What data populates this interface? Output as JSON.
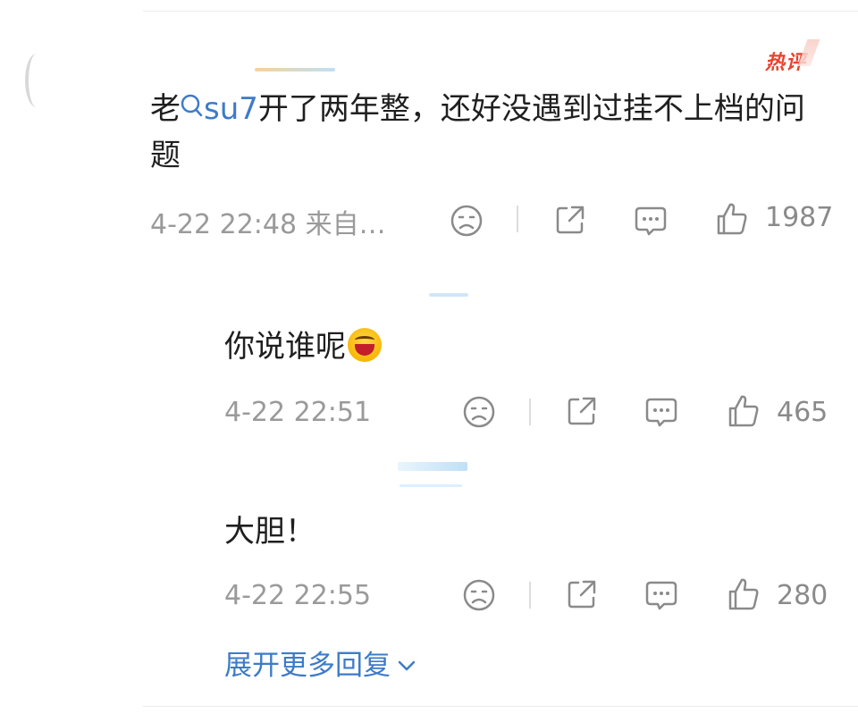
{
  "hot_tag": "热评",
  "main_comment": {
    "text_before": "老",
    "topic_icon": "search-icon",
    "topic": "su7",
    "text_after": "开了两年整，还好没遇到过挂不上档的问题",
    "time": "4-22 22:48 来自…",
    "likes": "1987"
  },
  "replies": [
    {
      "text": "你说谁呢",
      "emoji": "laugh-emoji",
      "time": "4-22 22:51",
      "likes": "465"
    },
    {
      "text": "大胆！",
      "time": "4-22 22:55",
      "likes": "280"
    }
  ],
  "expand_label": "展开更多回复",
  "colors": {
    "link": "#3d7bc9",
    "hot": "#e8432d",
    "meta": "#9a9a9a",
    "text": "#1f1f1f"
  }
}
